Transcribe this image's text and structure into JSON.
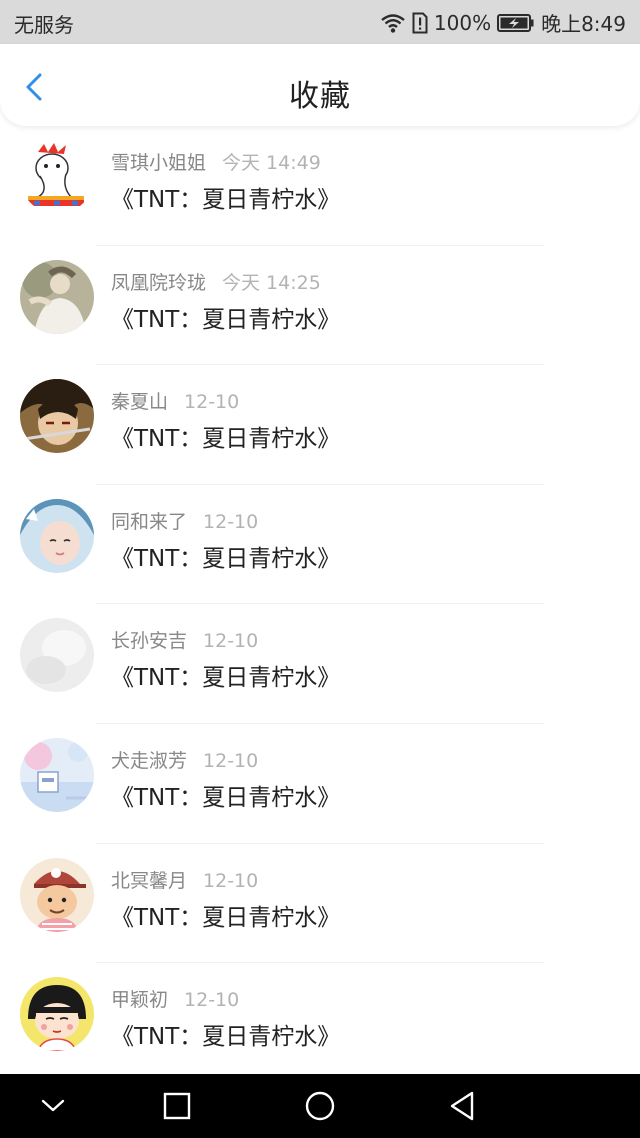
{
  "status_bar": {
    "carrier": "无服务",
    "battery": "100%",
    "time": "晚上8:49",
    "icons": [
      "wifi-icon",
      "sim-alert-icon",
      "battery-charging-icon"
    ]
  },
  "header": {
    "back_icon": "chevron-left-icon",
    "title": "收藏"
  },
  "favorites": [
    {
      "name": "雪琪小姐姐",
      "time": "今天 14:49",
      "title": "《TNT：夏日青柠水》",
      "avatar": "cartoon-character-avatar"
    },
    {
      "name": "凤凰院玲珑",
      "time": "今天 14:25",
      "title": "《TNT：夏日青柠水》",
      "avatar": "photo-person-avatar"
    },
    {
      "name": "秦夏山",
      "time": "12-10",
      "title": "《TNT：夏日青柠水》",
      "avatar": "anime-boy-avatar"
    },
    {
      "name": "同和来了",
      "time": "12-10",
      "title": "《TNT：夏日青柠水》",
      "avatar": "girl-costume-avatar"
    },
    {
      "name": "长孙安吉",
      "time": "12-10",
      "title": "《TNT：夏日青柠水》",
      "avatar": "blank-light-avatar"
    },
    {
      "name": "犬走淑芳",
      "time": "12-10",
      "title": "《TNT：夏日青柠水》",
      "avatar": "pastel-scene-avatar"
    },
    {
      "name": "北冥馨月",
      "time": "12-10",
      "title": "《TNT：夏日青柠水》",
      "avatar": "cartoon-boy-cap-avatar"
    },
    {
      "name": "甲颖初",
      "time": "12-10",
      "title": "《TNT：夏日青柠水》",
      "avatar": "maruko-girl-avatar"
    }
  ],
  "nav_bar": {
    "buttons": [
      "chevron-down-icon",
      "square-recents-icon",
      "circle-home-icon",
      "triangle-back-icon"
    ]
  },
  "colors": {
    "accent": "#2e8fe8",
    "status_bar_bg": "#dadada",
    "name_text": "#888888",
    "time_text": "#b3b3b3",
    "title_text": "#222222"
  }
}
